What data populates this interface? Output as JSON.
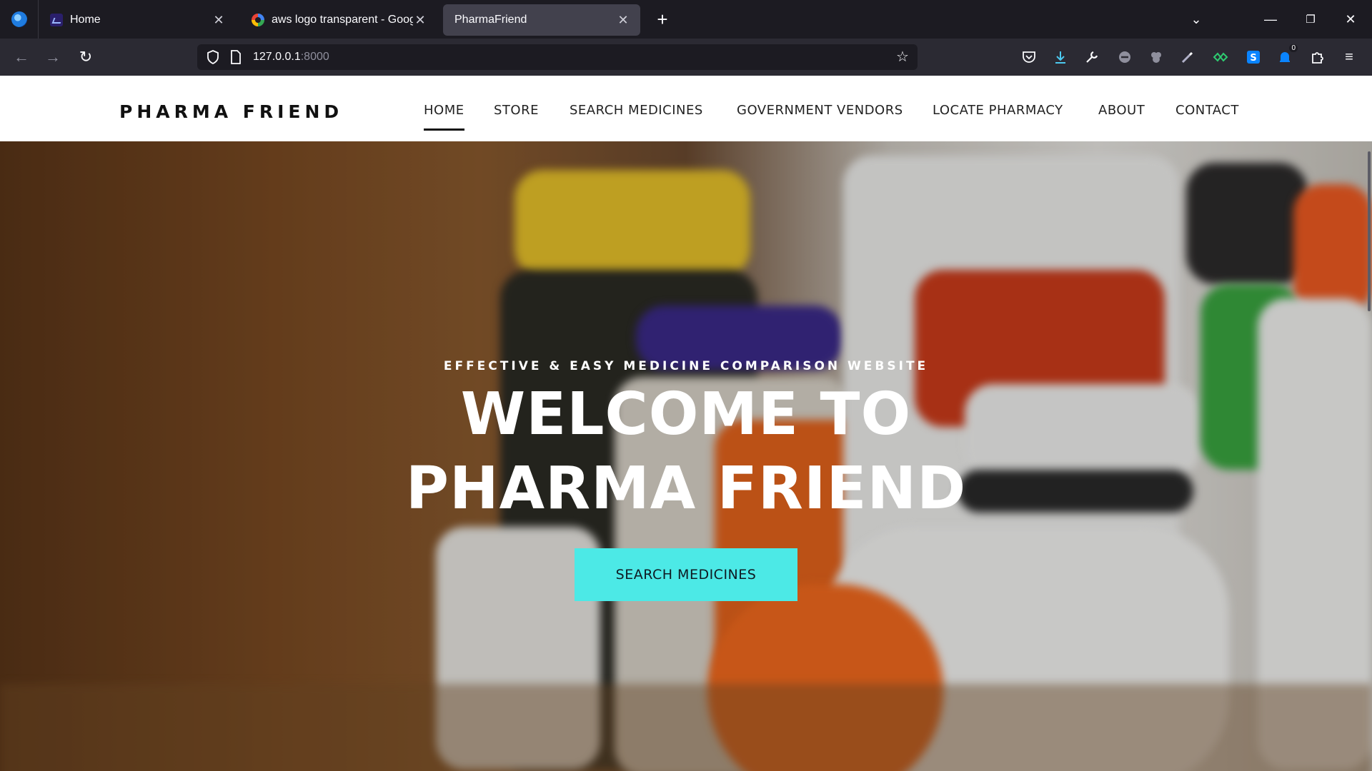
{
  "browser": {
    "tabs": [
      {
        "title": "Home",
        "active": false,
        "icon": "app-icon"
      },
      {
        "title": "aws logo transparent - Google ",
        "active": false,
        "icon": "google-icon"
      },
      {
        "title": "PharmaFriend",
        "active": true,
        "icon": ""
      }
    ],
    "url": {
      "host": "127.0.0.1",
      "port": ":8000"
    },
    "toolbar_badge": "0"
  },
  "site": {
    "brand": "PHARMA FRIEND",
    "menu": [
      "HOME",
      "STORE",
      "SEARCH MEDICINES",
      "GOVERNMENT VENDORS",
      "LOCATE PHARMACY",
      "ABOUT",
      "CONTACT"
    ],
    "active_menu": "HOME",
    "hero": {
      "tagline": "EFFECTIVE & EASY MEDICINE COMPARISON WEBSITE",
      "headline_line1": "WELCOME TO",
      "headline_line2": "PHARMA FRIEND",
      "cta_label": "SEARCH MEDICINES"
    }
  },
  "colors": {
    "accent": "#4ce9e6",
    "chrome_bg": "#1c1b22",
    "toolbar_bg": "#2b2a33"
  }
}
